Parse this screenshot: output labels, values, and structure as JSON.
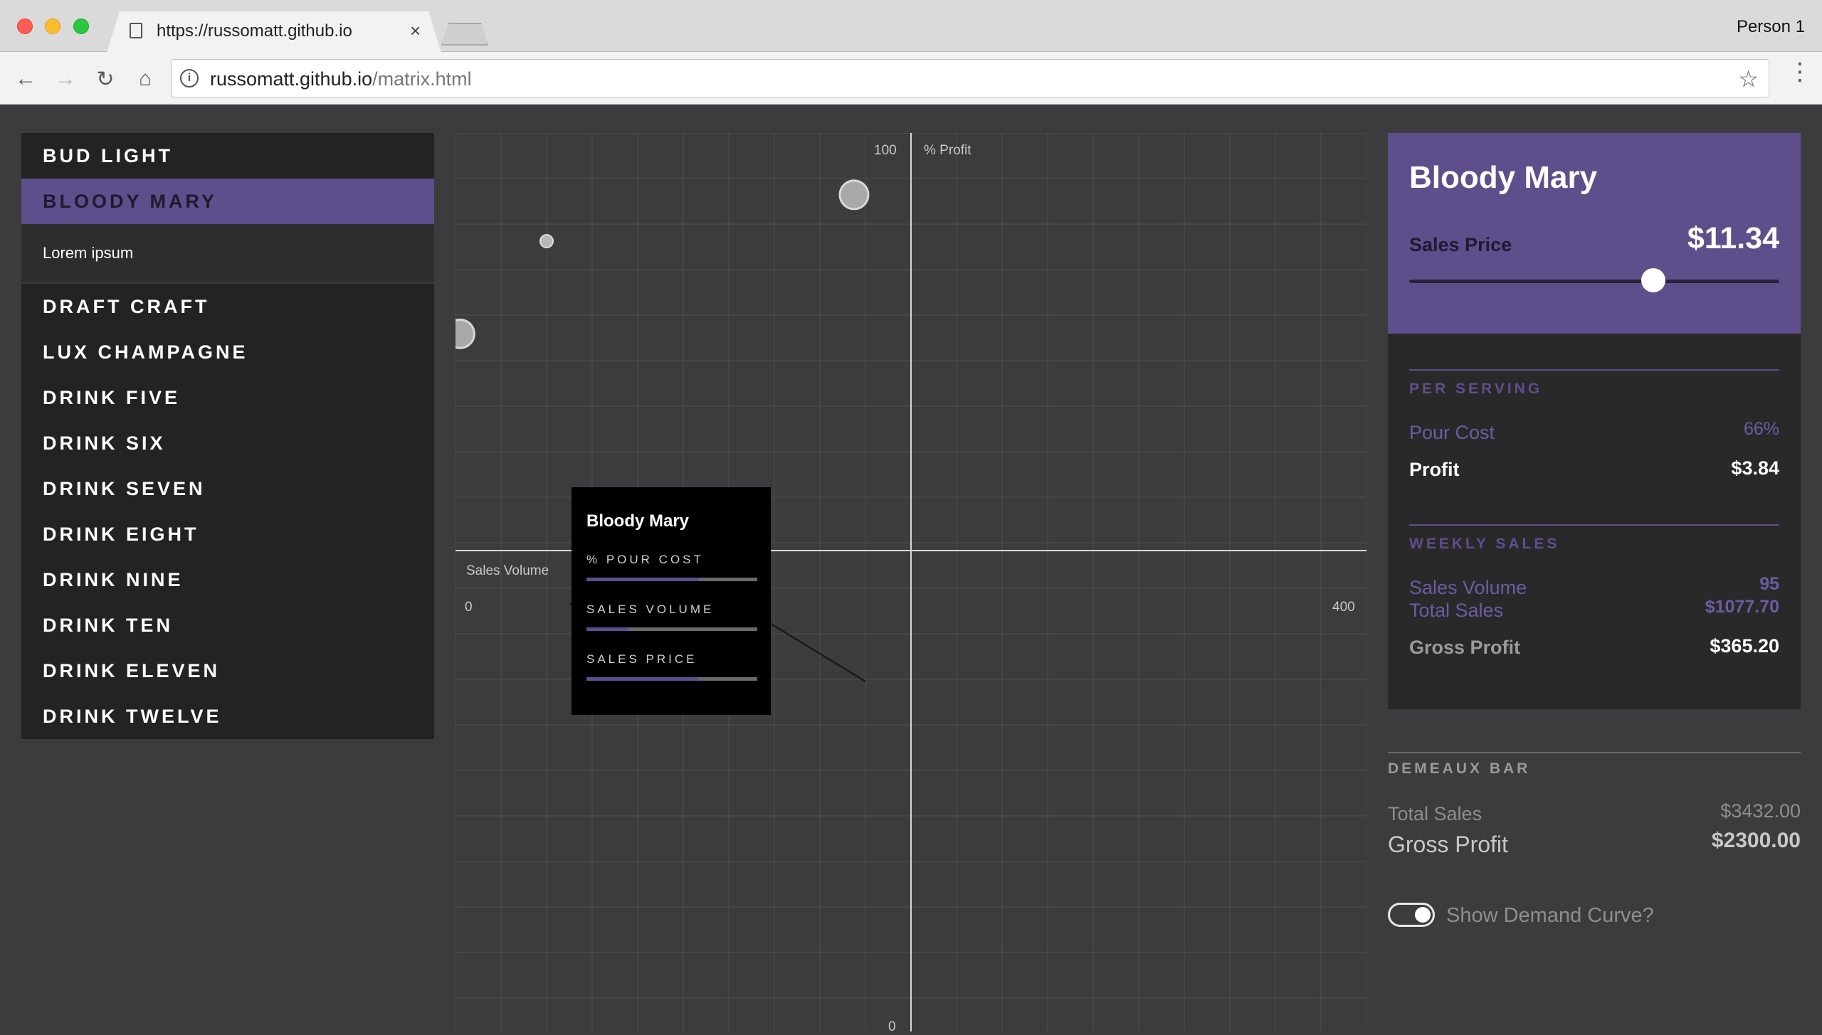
{
  "browser": {
    "tab_title": "https://russomatt.github.io",
    "tab_close": "×",
    "profile": "Person 1",
    "url_host": "russomatt.github.io",
    "url_path": "/matrix.html",
    "icons": {
      "back": "←",
      "forward": "→",
      "reload": "↻",
      "home": "⌂",
      "info": "i",
      "star": "☆",
      "menu": "⋮"
    }
  },
  "drinks": {
    "items": [
      "BUD LIGHT",
      "BLOODY MARY",
      "DRAFT CRAFT",
      "LUX CHAMPAGNE",
      "DRINK FIVE",
      "DRINK SIX",
      "DRINK SEVEN",
      "DRINK EIGHT",
      "DRINK NINE",
      "DRINK TEN",
      "DRINK ELEVEN",
      "DRINK TWELVE"
    ],
    "selected": "BLOODY MARY",
    "selected_detail": "Lorem ipsum"
  },
  "chart": {
    "y_axis_label": "% Profit",
    "y_max_label": "100",
    "y_min_label": "0",
    "x_axis_label": "Sales Volume",
    "x_min_label": "0",
    "x_max_label": "400"
  },
  "chart_data": {
    "type": "scatter",
    "xlabel": "Sales Volume",
    "ylabel": "% Profit",
    "xlim": [
      0,
      400
    ],
    "ylim": [
      0,
      100
    ],
    "ticks": {
      "x": [
        "0",
        "400"
      ],
      "y": [
        "0",
        "100"
      ]
    },
    "grid": true,
    "points": [
      {
        "x": 175,
        "y": 92,
        "size": "large"
      },
      {
        "x": 40,
        "y": 86,
        "size": "small"
      },
      {
        "x": 2,
        "y": 74,
        "size": "large"
      },
      {
        "x": 95,
        "y": 34,
        "size": "selected",
        "selected": true
      }
    ],
    "demand_curve": [
      [
        50,
        39
      ],
      [
        130,
        38
      ],
      [
        180,
        29
      ]
    ]
  },
  "tooltip": {
    "title": "Bloody Mary",
    "metrics": [
      {
        "label": "% POUR COST",
        "value": 0.66
      },
      {
        "label": "SALES VOLUME",
        "value": 0.24
      },
      {
        "label": "SALES PRICE",
        "value": 0.66
      }
    ]
  },
  "panel": {
    "title": "Bloody Mary",
    "price_label": "Sales Price",
    "price_value": "$11.34",
    "slider_level": 0.66,
    "per_serving": {
      "title": "PER SERVING",
      "pour_cost_label": "Pour Cost",
      "pour_cost_value": "66%",
      "profit_label": "Profit",
      "profit_value": "$3.84"
    },
    "weekly_sales": {
      "title": "WEEKLY SALES",
      "volume_label": "Sales Volume",
      "volume_value": "95",
      "total_label": "Total Sales",
      "total_value": "$1077.70",
      "gross_label": "Gross Profit",
      "gross_value": "$365.20"
    }
  },
  "bar_summary": {
    "title": "DEMEAUX BAR",
    "total_sales_label": "Total Sales",
    "total_sales_value": "$3432.00",
    "gross_profit_label": "Gross Profit",
    "gross_profit_value": "$2300.00"
  },
  "demand_toggle": {
    "label": "Show Demand Curve?",
    "on": true
  },
  "colors": {
    "accent": "#5f4e8c",
    "background": "#3c3c3e",
    "panel": "#29292a"
  }
}
